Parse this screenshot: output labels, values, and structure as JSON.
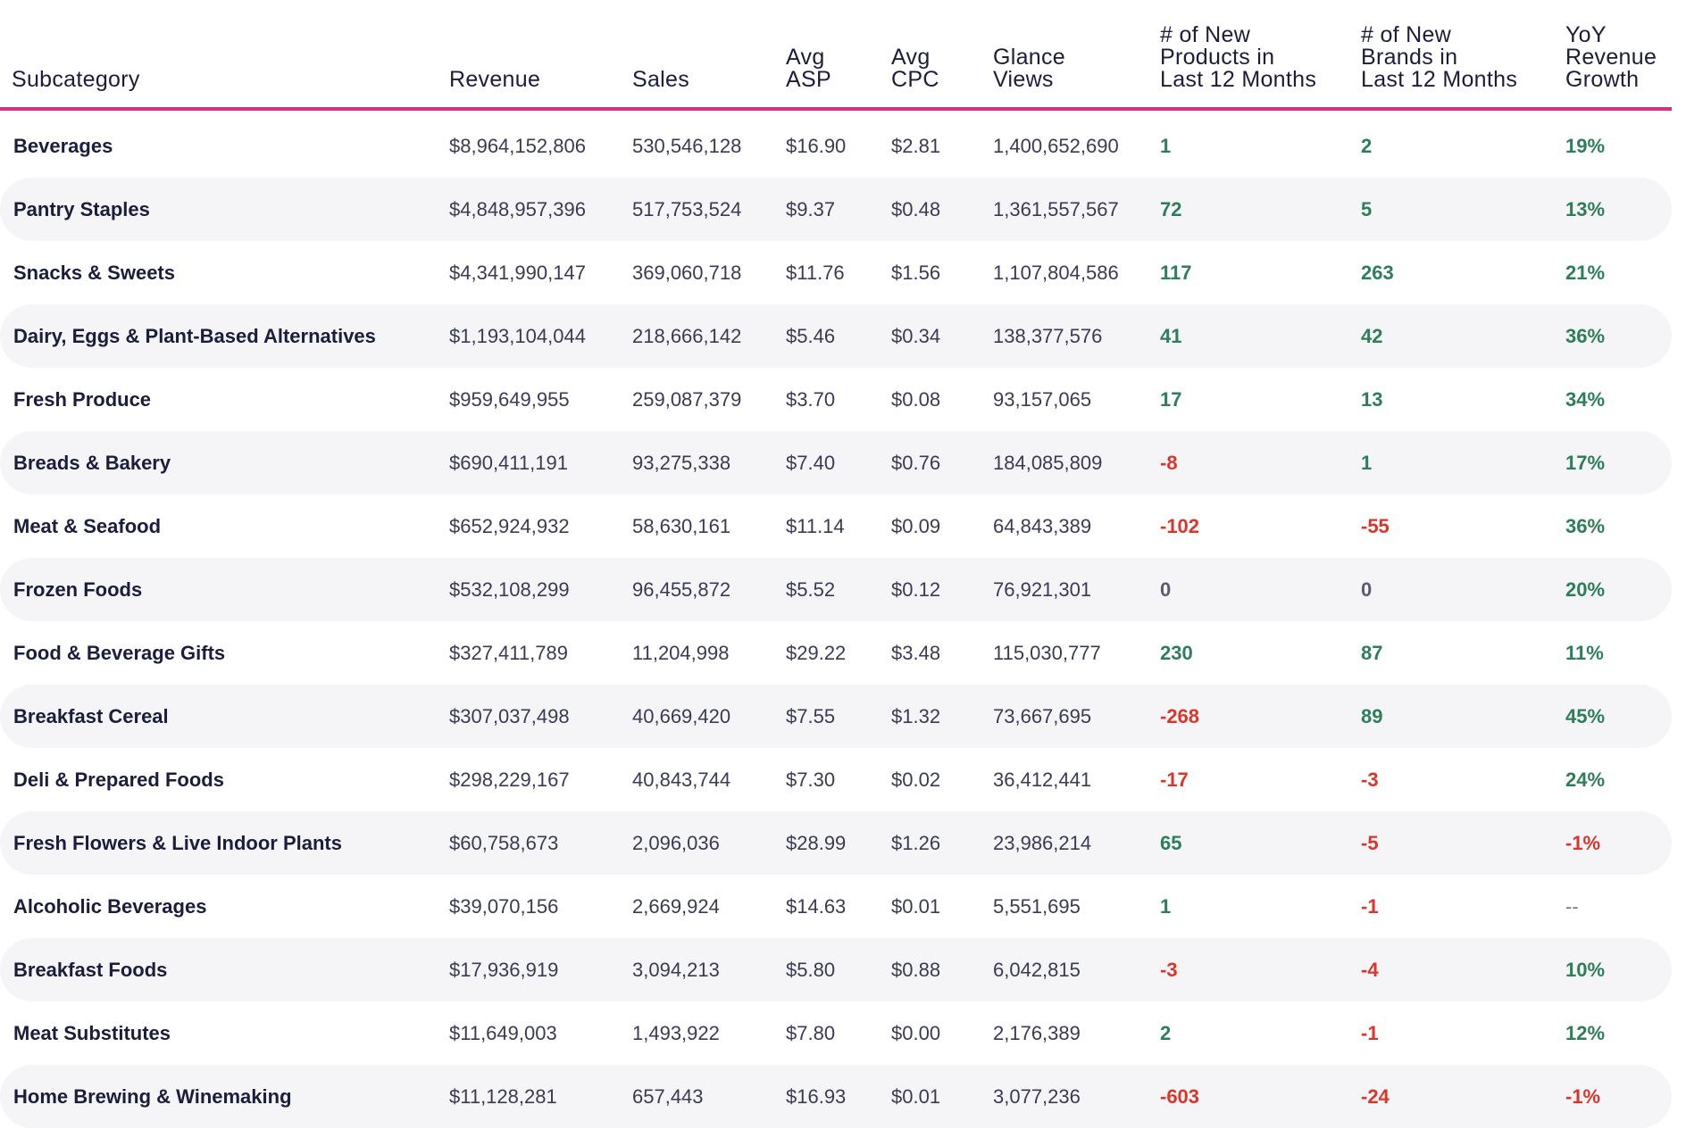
{
  "columns": [
    {
      "key": "subcategory",
      "lines": [
        "Subcategory"
      ]
    },
    {
      "key": "revenue",
      "lines": [
        "Revenue"
      ]
    },
    {
      "key": "sales",
      "lines": [
        "Sales"
      ]
    },
    {
      "key": "avg_asp",
      "lines": [
        "Avg",
        "ASP"
      ]
    },
    {
      "key": "avg_cpc",
      "lines": [
        "Avg",
        "CPC"
      ]
    },
    {
      "key": "glance_views",
      "lines": [
        "Glance",
        "Views"
      ]
    },
    {
      "key": "new_products",
      "lines": [
        "# of New",
        "Products in",
        "Last 12 Months"
      ]
    },
    {
      "key": "new_brands",
      "lines": [
        "# of New",
        "Brands in",
        "Last 12 Months"
      ]
    },
    {
      "key": "yoy",
      "lines": [
        "YoY",
        "Revenue",
        "Growth"
      ]
    }
  ],
  "colors": {
    "accent_line": "#d8317f",
    "positive": "#2e7d5b",
    "negative": "#d9362b",
    "row_alt": "#f5f5f7"
  },
  "rows": [
    {
      "subcategory": "Beverages",
      "revenue": "$8,964,152,806",
      "sales": "530,546,128",
      "avg_asp": "$16.90",
      "avg_cpc": "$2.81",
      "glance_views": "1,400,652,690",
      "new_products": "1",
      "new_brands": "2",
      "yoy": "19%"
    },
    {
      "subcategory": "Pantry Staples",
      "revenue": "$4,848,957,396",
      "sales": "517,753,524",
      "avg_asp": "$9.37",
      "avg_cpc": "$0.48",
      "glance_views": "1,361,557,567",
      "new_products": "72",
      "new_brands": "5",
      "yoy": "13%"
    },
    {
      "subcategory": "Snacks & Sweets",
      "revenue": "$4,341,990,147",
      "sales": "369,060,718",
      "avg_asp": "$11.76",
      "avg_cpc": "$1.56",
      "glance_views": "1,107,804,586",
      "new_products": "117",
      "new_brands": "263",
      "yoy": "21%"
    },
    {
      "subcategory": "Dairy, Eggs & Plant-Based Alternatives",
      "revenue": "$1,193,104,044",
      "sales": "218,666,142",
      "avg_asp": "$5.46",
      "avg_cpc": "$0.34",
      "glance_views": "138,377,576",
      "new_products": "41",
      "new_brands": "42",
      "yoy": "36%"
    },
    {
      "subcategory": "Fresh Produce",
      "revenue": "$959,649,955",
      "sales": "259,087,379",
      "avg_asp": "$3.70",
      "avg_cpc": "$0.08",
      "glance_views": "93,157,065",
      "new_products": "17",
      "new_brands": "13",
      "yoy": "34%"
    },
    {
      "subcategory": "Breads & Bakery",
      "revenue": "$690,411,191",
      "sales": "93,275,338",
      "avg_asp": "$7.40",
      "avg_cpc": "$0.76",
      "glance_views": "184,085,809",
      "new_products": "-8",
      "new_brands": "1",
      "yoy": "17%"
    },
    {
      "subcategory": "Meat & Seafood",
      "revenue": "$652,924,932",
      "sales": "58,630,161",
      "avg_asp": "$11.14",
      "avg_cpc": "$0.09",
      "glance_views": "64,843,389",
      "new_products": "-102",
      "new_brands": "-55",
      "yoy": "36%"
    },
    {
      "subcategory": "Frozen Foods",
      "revenue": "$532,108,299",
      "sales": "96,455,872",
      "avg_asp": "$5.52",
      "avg_cpc": "$0.12",
      "glance_views": "76,921,301",
      "new_products": "0",
      "new_brands": "0",
      "yoy": "20%"
    },
    {
      "subcategory": "Food & Beverage Gifts",
      "revenue": "$327,411,789",
      "sales": "11,204,998",
      "avg_asp": "$29.22",
      "avg_cpc": "$3.48",
      "glance_views": "115,030,777",
      "new_products": "230",
      "new_brands": "87",
      "yoy": "11%"
    },
    {
      "subcategory": "Breakfast Cereal",
      "revenue": "$307,037,498",
      "sales": "40,669,420",
      "avg_asp": "$7.55",
      "avg_cpc": "$1.32",
      "glance_views": "73,667,695",
      "new_products": "-268",
      "new_brands": "89",
      "yoy": "45%"
    },
    {
      "subcategory": "Deli & Prepared Foods",
      "revenue": "$298,229,167",
      "sales": "40,843,744",
      "avg_asp": "$7.30",
      "avg_cpc": "$0.02",
      "glance_views": "36,412,441",
      "new_products": "-17",
      "new_brands": "-3",
      "yoy": "24%"
    },
    {
      "subcategory": "Fresh Flowers & Live Indoor Plants",
      "revenue": "$60,758,673",
      "sales": "2,096,036",
      "avg_asp": "$28.99",
      "avg_cpc": "$1.26",
      "glance_views": "23,986,214",
      "new_products": "65",
      "new_brands": "-5",
      "yoy": "-1%"
    },
    {
      "subcategory": "Alcoholic Beverages",
      "revenue": "$39,070,156",
      "sales": "2,669,924",
      "avg_asp": "$14.63",
      "avg_cpc": "$0.01",
      "glance_views": "5,551,695",
      "new_products": "1",
      "new_brands": "-1",
      "yoy": "--"
    },
    {
      "subcategory": "Breakfast Foods",
      "revenue": "$17,936,919",
      "sales": "3,094,213",
      "avg_asp": "$5.80",
      "avg_cpc": "$0.88",
      "glance_views": "6,042,815",
      "new_products": "-3",
      "new_brands": "-4",
      "yoy": "10%"
    },
    {
      "subcategory": "Meat Substitutes",
      "revenue": "$11,649,003",
      "sales": "1,493,922",
      "avg_asp": "$7.80",
      "avg_cpc": "$0.00",
      "glance_views": "2,176,389",
      "new_products": "2",
      "new_brands": "-1",
      "yoy": "12%"
    },
    {
      "subcategory": "Home Brewing & Winemaking",
      "revenue": "$11,128,281",
      "sales": "657,443",
      "avg_asp": "$16.93",
      "avg_cpc": "$0.01",
      "glance_views": "3,077,236",
      "new_products": "-603",
      "new_brands": "-24",
      "yoy": "-1%"
    }
  ]
}
